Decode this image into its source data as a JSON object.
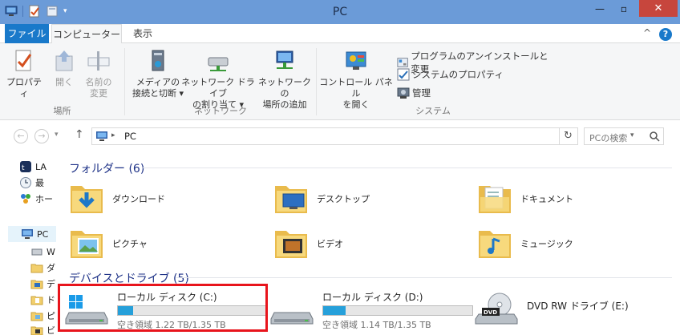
{
  "window": {
    "title": "PC"
  },
  "ribbon_tabs": {
    "file": "ファイル",
    "computer": "コンピューター",
    "view": "表示",
    "collapse": "^",
    "help": "?"
  },
  "ribbon": {
    "location_group": {
      "label": "場所",
      "properties": "プロパティ",
      "open": "開く",
      "rename_line1": "名前の",
      "rename_line2": "変更"
    },
    "network_group": {
      "label": "ネットワーク",
      "media_line1": "メディアの",
      "media_line2": "接続と切断 ▾",
      "map_line1": "ネットワーク ドライブ",
      "map_line2": "の割り当て ▾",
      "add_line1": "ネットワークの",
      "add_line2": "場所の追加"
    },
    "system_group": {
      "label": "システム",
      "control_line1": "コントロール パネル",
      "control_line2": "を開く",
      "uninstall": "プログラムのアンインストールと変更",
      "sysprops": "システムのプロパティ",
      "manage": "管理"
    }
  },
  "address": {
    "path": "PC",
    "search_placeholder": "PCの検索"
  },
  "nav_pane": {
    "items": [
      {
        "label": "LA"
      },
      {
        "label": "最"
      },
      {
        "label": "ホー"
      },
      {
        "label": "PC"
      },
      {
        "label": "W"
      },
      {
        "label": "ダ"
      },
      {
        "label": "デ"
      },
      {
        "label": "ド"
      },
      {
        "label": "ピ"
      },
      {
        "label": "ビ"
      }
    ]
  },
  "folders": {
    "header": "フォルダー (6)",
    "items": [
      {
        "label": "ダウンロード",
        "icon": "download-folder-icon"
      },
      {
        "label": "デスクトップ",
        "icon": "desktop-folder-icon"
      },
      {
        "label": "ドキュメント",
        "icon": "documents-folder-icon"
      },
      {
        "label": "ピクチャ",
        "icon": "pictures-folder-icon"
      },
      {
        "label": "ビデオ",
        "icon": "videos-folder-icon"
      },
      {
        "label": "ミュージック",
        "icon": "music-folder-icon"
      }
    ]
  },
  "drives": {
    "header": "デバイスとドライブ (5)",
    "items": [
      {
        "name": "ローカル ディスク (C:)",
        "free": "空き領域 1.22 TB/1.35 TB",
        "used_fraction": 0.1
      },
      {
        "name": "ローカル ディスク (D:)",
        "free": "空き領域 1.14 TB/1.35 TB",
        "used_fraction": 0.15
      },
      {
        "name": "DVD RW ドライブ (E:)",
        "free": "",
        "used_fraction": 0
      }
    ]
  },
  "colors": {
    "accent": "#1979ca",
    "usage_bar": "#26a0da",
    "highlight": "#e8141c",
    "header_text": "#1e3287"
  }
}
